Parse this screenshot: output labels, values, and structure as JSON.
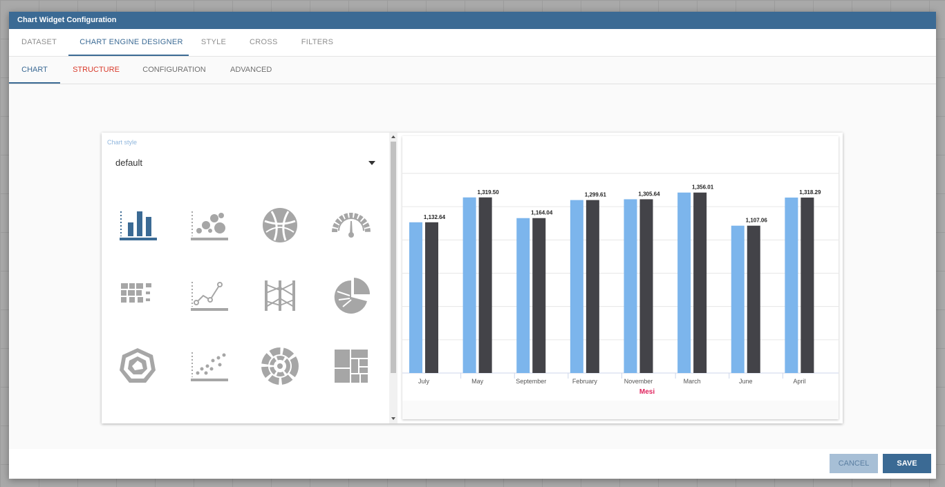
{
  "dialog": {
    "title": "Chart Widget Configuration"
  },
  "tabs_main": [
    {
      "label": "DATASET",
      "active": false
    },
    {
      "label": "CHART ENGINE DESIGNER",
      "active": true
    },
    {
      "label": "STYLE",
      "active": false
    },
    {
      "label": "CROSS",
      "active": false
    },
    {
      "label": "FILTERS",
      "active": false
    }
  ],
  "tabs_sub": [
    {
      "label": "CHART",
      "active": true
    },
    {
      "label": "STRUCTURE",
      "error": true
    },
    {
      "label": "CONFIGURATION"
    },
    {
      "label": "ADVANCED"
    }
  ],
  "chart_style": {
    "label": "Chart style",
    "value": "default"
  },
  "chart_types": [
    {
      "icon": "bar-chart-icon",
      "selected": true
    },
    {
      "icon": "bubble-chart-icon"
    },
    {
      "icon": "chord-chart-icon"
    },
    {
      "icon": "gauge-chart-icon"
    },
    {
      "icon": "heatmap-chart-icon"
    },
    {
      "icon": "line-chart-icon"
    },
    {
      "icon": "parallel-chart-icon"
    },
    {
      "icon": "pie-chart-icon"
    },
    {
      "icon": "radar-chart-icon"
    },
    {
      "icon": "scatter-chart-icon"
    },
    {
      "icon": "sunburst-chart-icon"
    },
    {
      "icon": "treemap-chart-icon"
    }
  ],
  "chart_data": {
    "type": "bar",
    "categories": [
      "July",
      "May",
      "September",
      "February",
      "November",
      "March",
      "June",
      "April"
    ],
    "series": [
      {
        "values": [
          1132.64,
          1319.5,
          1164.04,
          1299.61,
          1305.64,
          1356.01,
          1107.06,
          1318.29
        ]
      },
      {
        "values": [
          1132.64,
          1319.5,
          1164.04,
          1299.61,
          1305.64,
          1356.01,
          1107.06,
          1318.29
        ]
      }
    ],
    "data_labels": [
      "1,132.64",
      "1,319.50",
      "1,164.04",
      "1,299.61",
      "1,305.64",
      "1,356.01",
      "1,107.06",
      "1,318.29"
    ],
    "xlabel": "Mesi",
    "ylabel": "",
    "ylim": [
      0,
      1500
    ],
    "grid": true,
    "colors": [
      "#7cb5ec",
      "#434348"
    ],
    "xlabel_color": "#e0245e"
  },
  "footer": {
    "cancel_label": "CANCEL",
    "save_label": "SAVE"
  },
  "colors": {
    "accent": "#3b6a94",
    "error": "#d93a2b",
    "icon_grey": "#a6a6a6"
  }
}
